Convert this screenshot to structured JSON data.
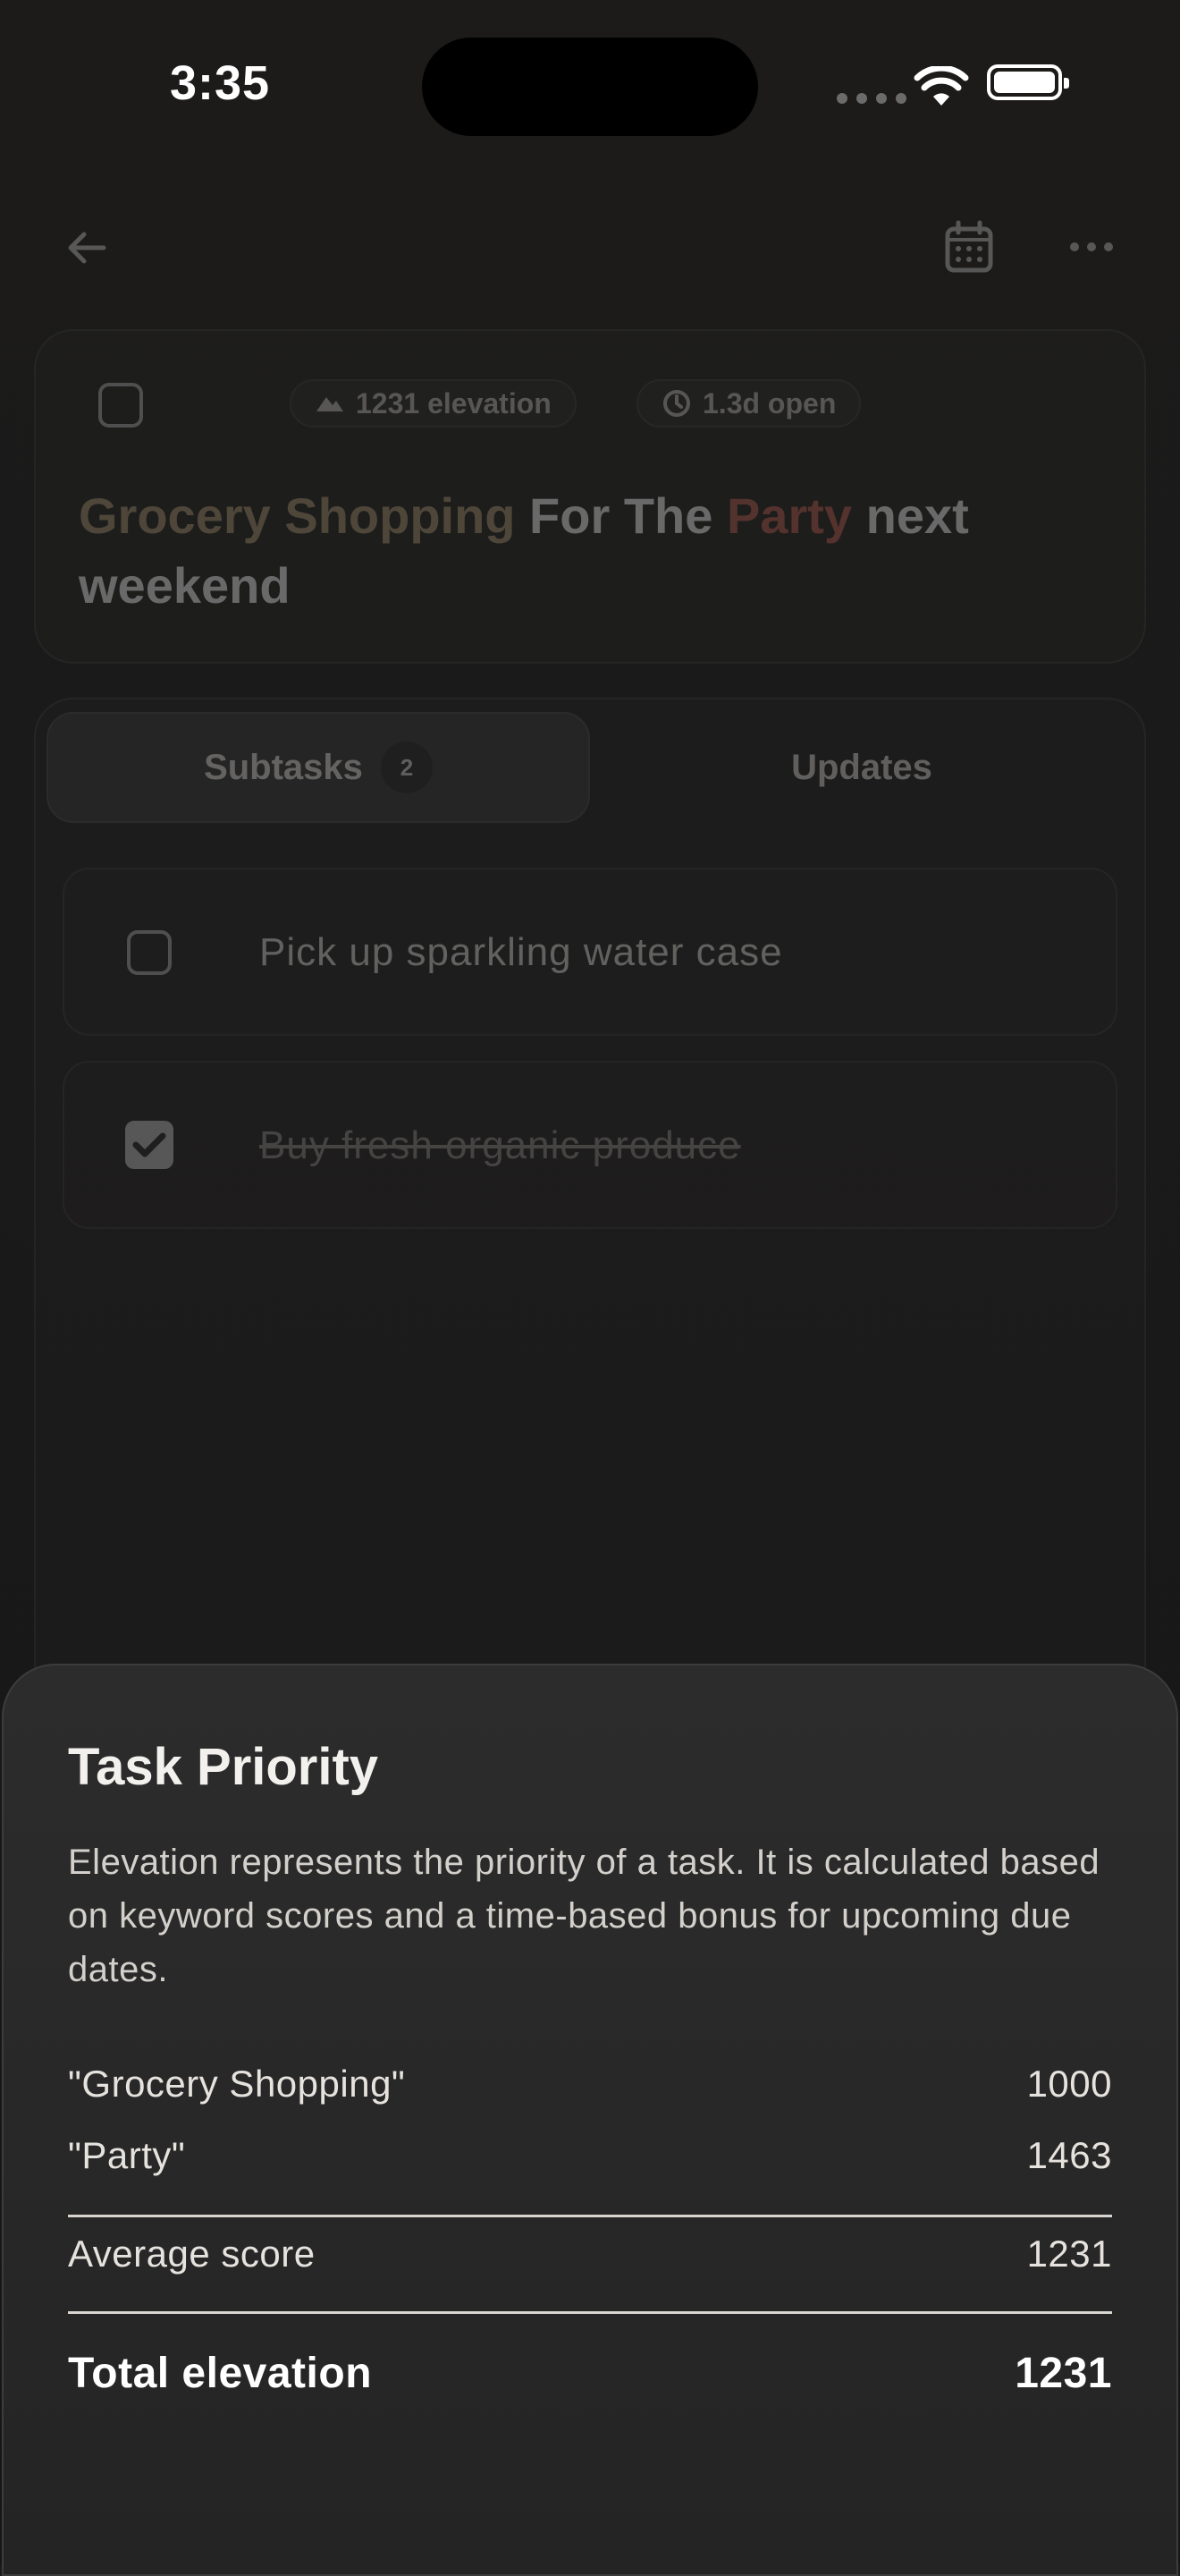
{
  "status_bar": {
    "time": "3:35"
  },
  "header": {
    "back_icon": "arrow-left-icon",
    "calendar_icon": "calendar-icon",
    "more_icon": "more-horizontal-icon"
  },
  "task": {
    "elevation_chip": "1231 elevation",
    "open_chip": "1.3d open",
    "title_parts": [
      "Grocery Shopping",
      " For The ",
      "Party",
      " next weekend"
    ],
    "keyword_colors": {
      "grocery_shopping": "#a89070",
      "party": "#b65a4e"
    }
  },
  "tabs": {
    "subtasks_label": "Subtasks",
    "subtasks_count": "2",
    "updates_label": "Updates"
  },
  "subtasks": [
    {
      "label": "Pick up sparkling water case",
      "done": false
    },
    {
      "label": "Buy fresh organic produce",
      "done": true
    }
  ],
  "sheet": {
    "title": "Task Priority",
    "description": "Elevation represents the priority of a task. It is calculated based on keyword scores and a time-based bonus for upcoming due dates.",
    "keywords": [
      {
        "label": "\"Grocery Shopping\"",
        "score": "1000"
      },
      {
        "label": "\"Party\"",
        "score": "1463"
      }
    ],
    "average_label": "Average score",
    "average_value": "1231",
    "total_label": "Total elevation",
    "total_value": "1231"
  }
}
